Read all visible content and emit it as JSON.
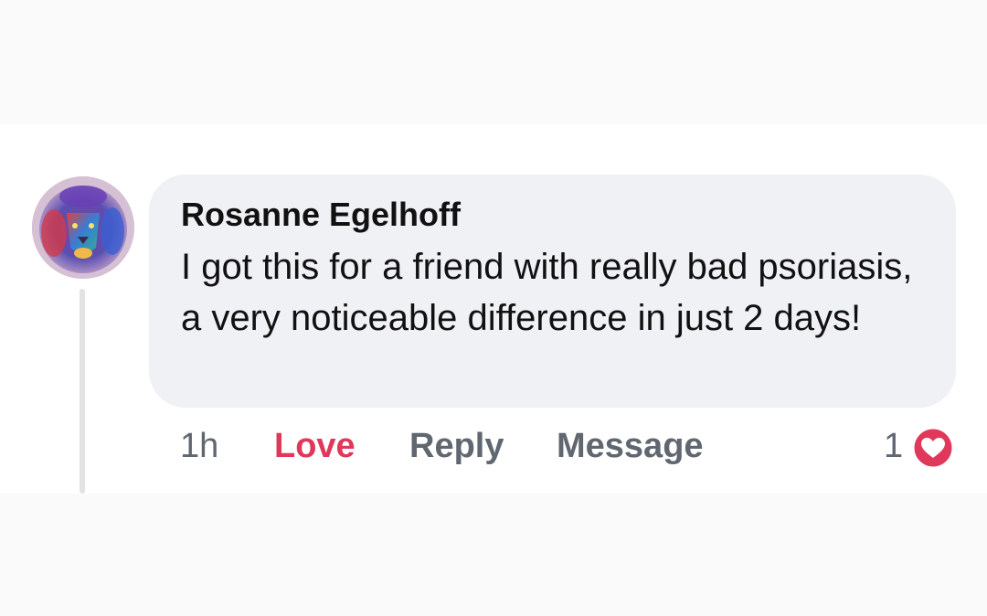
{
  "comment": {
    "author": "Rosanne Egelhoff",
    "text": "I got this for a friend with really bad psoriasis, a very noticeable difference in just 2 days!",
    "avatar_icon": "lion-avatar"
  },
  "actions": {
    "time": "1h",
    "love_label": "Love",
    "reply_label": "Reply",
    "message_label": "Message"
  },
  "reactions": {
    "count": "1",
    "icon": "heart-icon",
    "color": "#e0385a"
  },
  "colors": {
    "bubble": "#f0f1f5",
    "love": "#e0385a",
    "secondary_text": "#606770"
  }
}
